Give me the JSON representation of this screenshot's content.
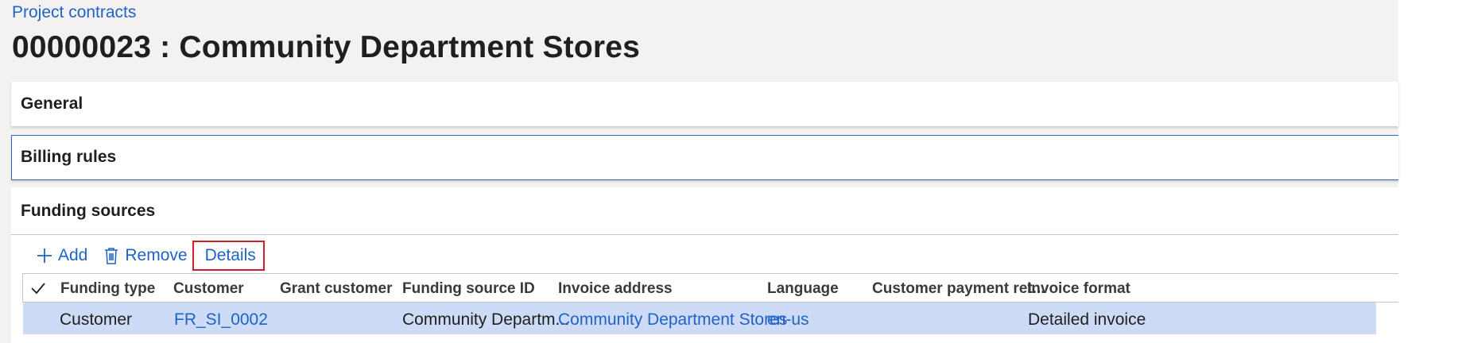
{
  "breadcrumb": {
    "label": "Project contracts"
  },
  "page": {
    "title": "00000023 : Community Department Stores"
  },
  "fasttabs": {
    "general": "General",
    "billing_rules": "Billing rules",
    "funding_sources": "Funding sources"
  },
  "actions": {
    "add": "Add",
    "remove": "Remove",
    "details": "Details"
  },
  "grid": {
    "columns": [
      "Funding type",
      "Customer",
      "Grant customer",
      "Funding source ID",
      "Invoice address",
      "Language",
      "Customer payment ret...",
      "Invoice format"
    ],
    "rows": [
      {
        "funding_type": "Customer",
        "customer": "FR_SI_0002",
        "grant_customer": "",
        "funding_source_id": "Community Departm...",
        "invoice_address": "Community Department Stores",
        "language": "en-us",
        "customer_payment_retention": "",
        "invoice_format": "Detailed invoice"
      }
    ]
  },
  "colors": {
    "link": "#1f63c6",
    "selected_row": "#cddbf6",
    "focus_border": "#2b68c7",
    "highlight_box": "#d21e2b"
  },
  "icons": [
    "add-icon",
    "remove-icon",
    "select-all-checkmark-icon"
  ]
}
